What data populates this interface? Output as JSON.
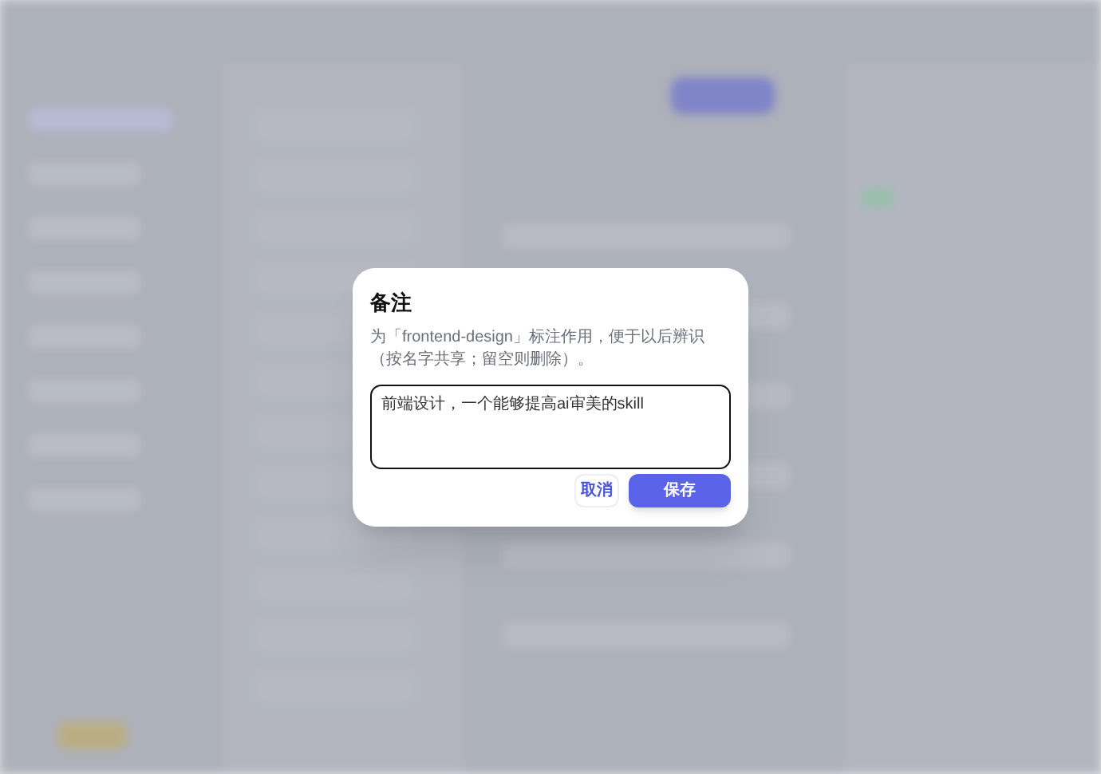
{
  "dialog": {
    "title": "备注",
    "description": "为「frontend-design」标注作用，便于以后辨识（按名字共享；留空则删除）。",
    "note": {
      "value": "前端设计，一个能够提高ai审美的skill"
    },
    "buttons": [
      {
        "label": "取消",
        "kind": "secondary"
      },
      {
        "label": "保存",
        "kind": "primary"
      }
    ]
  }
}
